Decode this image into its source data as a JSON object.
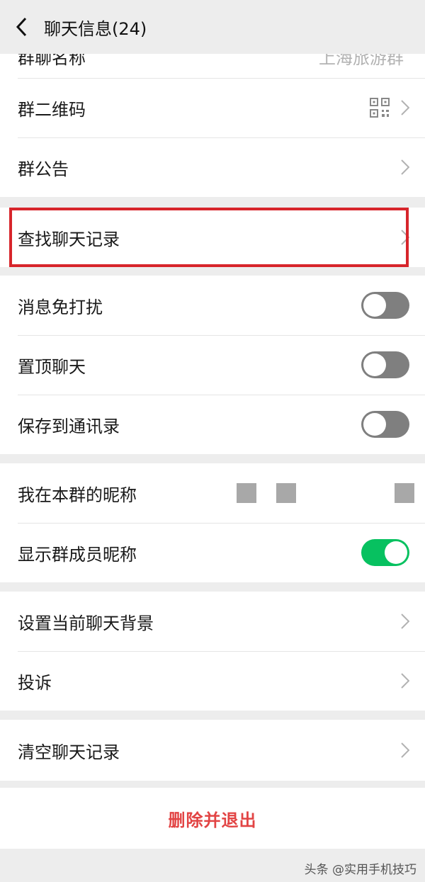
{
  "header": {
    "title": "聊天信息(24)"
  },
  "partial_row": {
    "label": "群聊名称",
    "value": "上海旅游群"
  },
  "section1": [
    {
      "label": "群二维码"
    },
    {
      "label": "群公告"
    }
  ],
  "search_row": {
    "label": "查找聊天记录"
  },
  "toggles": [
    {
      "label": "消息免打扰",
      "state": false
    },
    {
      "label": "置顶聊天",
      "state": false
    },
    {
      "label": "保存到通讯录",
      "state": false
    }
  ],
  "nickname_section": {
    "my_nickname_label": "我在本群的昵称",
    "show_nickname_label": "显示群成员昵称",
    "show_nickname_state": true
  },
  "section5": [
    {
      "label": "设置当前聊天背景"
    },
    {
      "label": "投诉"
    }
  ],
  "clear_row": {
    "label": "清空聊天记录"
  },
  "delete_button": {
    "label": "删除并退出"
  },
  "watermark": {
    "text": "头条 @实用手机技巧"
  },
  "colors": {
    "accent_green": "#07c160",
    "danger_red": "#e24444",
    "highlight_red": "#d7252b"
  }
}
